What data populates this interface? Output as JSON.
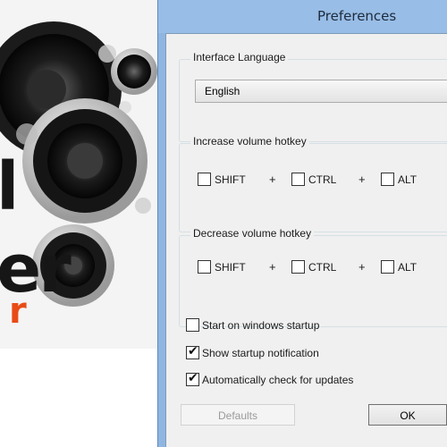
{
  "background_app": {
    "artwork_letters": [
      "l",
      "er"
    ],
    "artwork_subtext": "r"
  },
  "dialog": {
    "title": "Preferences",
    "language_group": {
      "title": "Interface Language",
      "selected": "English"
    },
    "increase_group": {
      "title": "Increase volume hotkey",
      "shift": {
        "label": "SHIFT",
        "checked": false
      },
      "ctrl": {
        "label": "CTRL",
        "checked": false
      },
      "alt": {
        "label": "ALT",
        "checked": false
      },
      "plus": "+"
    },
    "decrease_group": {
      "title": "Decrease volume hotkey",
      "shift": {
        "label": "SHIFT",
        "checked": false
      },
      "ctrl": {
        "label": "CTRL",
        "checked": false
      },
      "alt": {
        "label": "ALT",
        "checked": false
      },
      "plus": "+"
    },
    "options": {
      "startup": {
        "label": "Start on windows startup",
        "checked": false
      },
      "notification": {
        "label": "Show startup notification",
        "checked": true
      },
      "updates": {
        "label": "Automatically check for updates",
        "checked": true
      }
    },
    "buttons": {
      "defaults": "Defaults",
      "ok": "OK"
    },
    "check_glyph": "✔"
  },
  "colors": {
    "accent_orange": "#e94b16",
    "titlebar": "#98bde6"
  }
}
